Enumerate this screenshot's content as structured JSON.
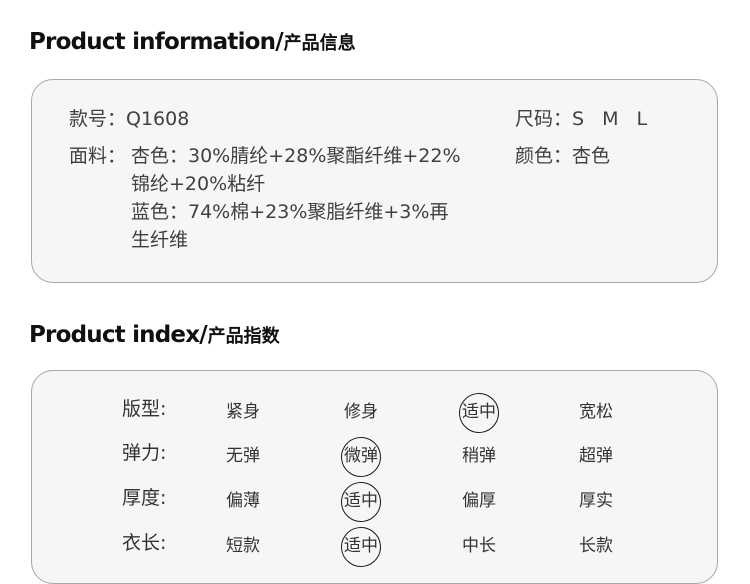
{
  "sections": {
    "info": {
      "title_en": "Product information",
      "slash": "/",
      "title_zh": "产品信息"
    },
    "index": {
      "title_en": "Product index",
      "slash": "/",
      "title_zh": "产品指数"
    }
  },
  "info": {
    "style_no_label": "款号：",
    "style_no_value": "Q1608",
    "size_label": "尺码：",
    "sizes": [
      "S",
      "M",
      "L"
    ],
    "fabric_label": "面料：",
    "fabric_lines": [
      "杏色：30%腈纶+28%聚酯纤维+22%",
      "锦纶+20%粘纤",
      "蓝色：74%棉+23%聚脂纤维+3%再",
      "生纤维"
    ],
    "color_label": "颜色：",
    "color_value": "杏色"
  },
  "index": {
    "rows": [
      {
        "label": "版型:",
        "options": [
          "紧身",
          "修身",
          "适中",
          "宽松"
        ],
        "selected_index": 2
      },
      {
        "label": "弹力:",
        "options": [
          "无弹",
          "微弹",
          "稍弹",
          "超弹"
        ],
        "selected_index": 1
      },
      {
        "label": "厚度:",
        "options": [
          "偏薄",
          "适中",
          "偏厚",
          "厚实"
        ],
        "selected_index": 1
      },
      {
        "label": "衣长:",
        "options": [
          "短款",
          "适中",
          "中长",
          "长款"
        ],
        "selected_index": 1
      }
    ]
  }
}
